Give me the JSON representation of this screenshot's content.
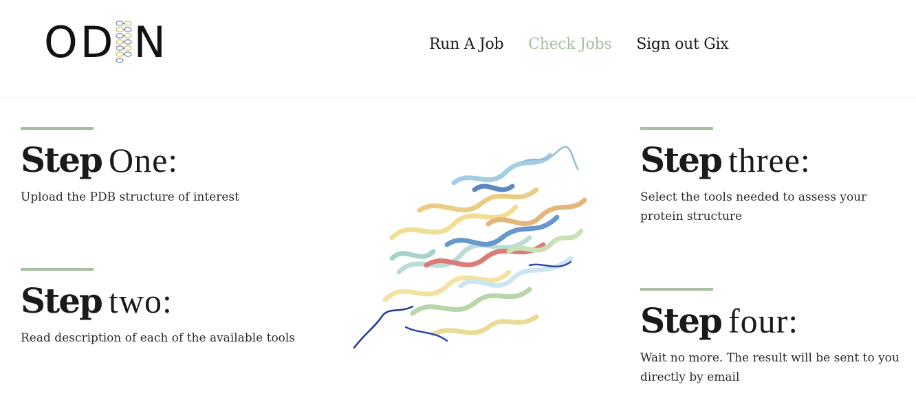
{
  "header": {
    "logo_text_left": "OD",
    "logo_text_right": "N",
    "nav": [
      "Run A Job",
      "Check Jobs",
      "Sign out Gix"
    ],
    "active_nav": "Check Jobs"
  },
  "steps": [
    {
      "strong": "Step",
      "light": "One:",
      "desc": "Upload the PDB structure of interest"
    },
    {
      "strong": "Step",
      "light": "two:",
      "desc": "Read description of each of the available tools"
    },
    {
      "strong": "Step",
      "light": "three:",
      "desc": "Select the tools needed to assess your protein structure"
    },
    {
      "strong": "Step",
      "light": "four:",
      "desc": "Wait no more. The result will be sent to you directly by email"
    }
  ],
  "colors": {
    "accent": "#a9bfa3",
    "text": "#1a1a1a"
  }
}
